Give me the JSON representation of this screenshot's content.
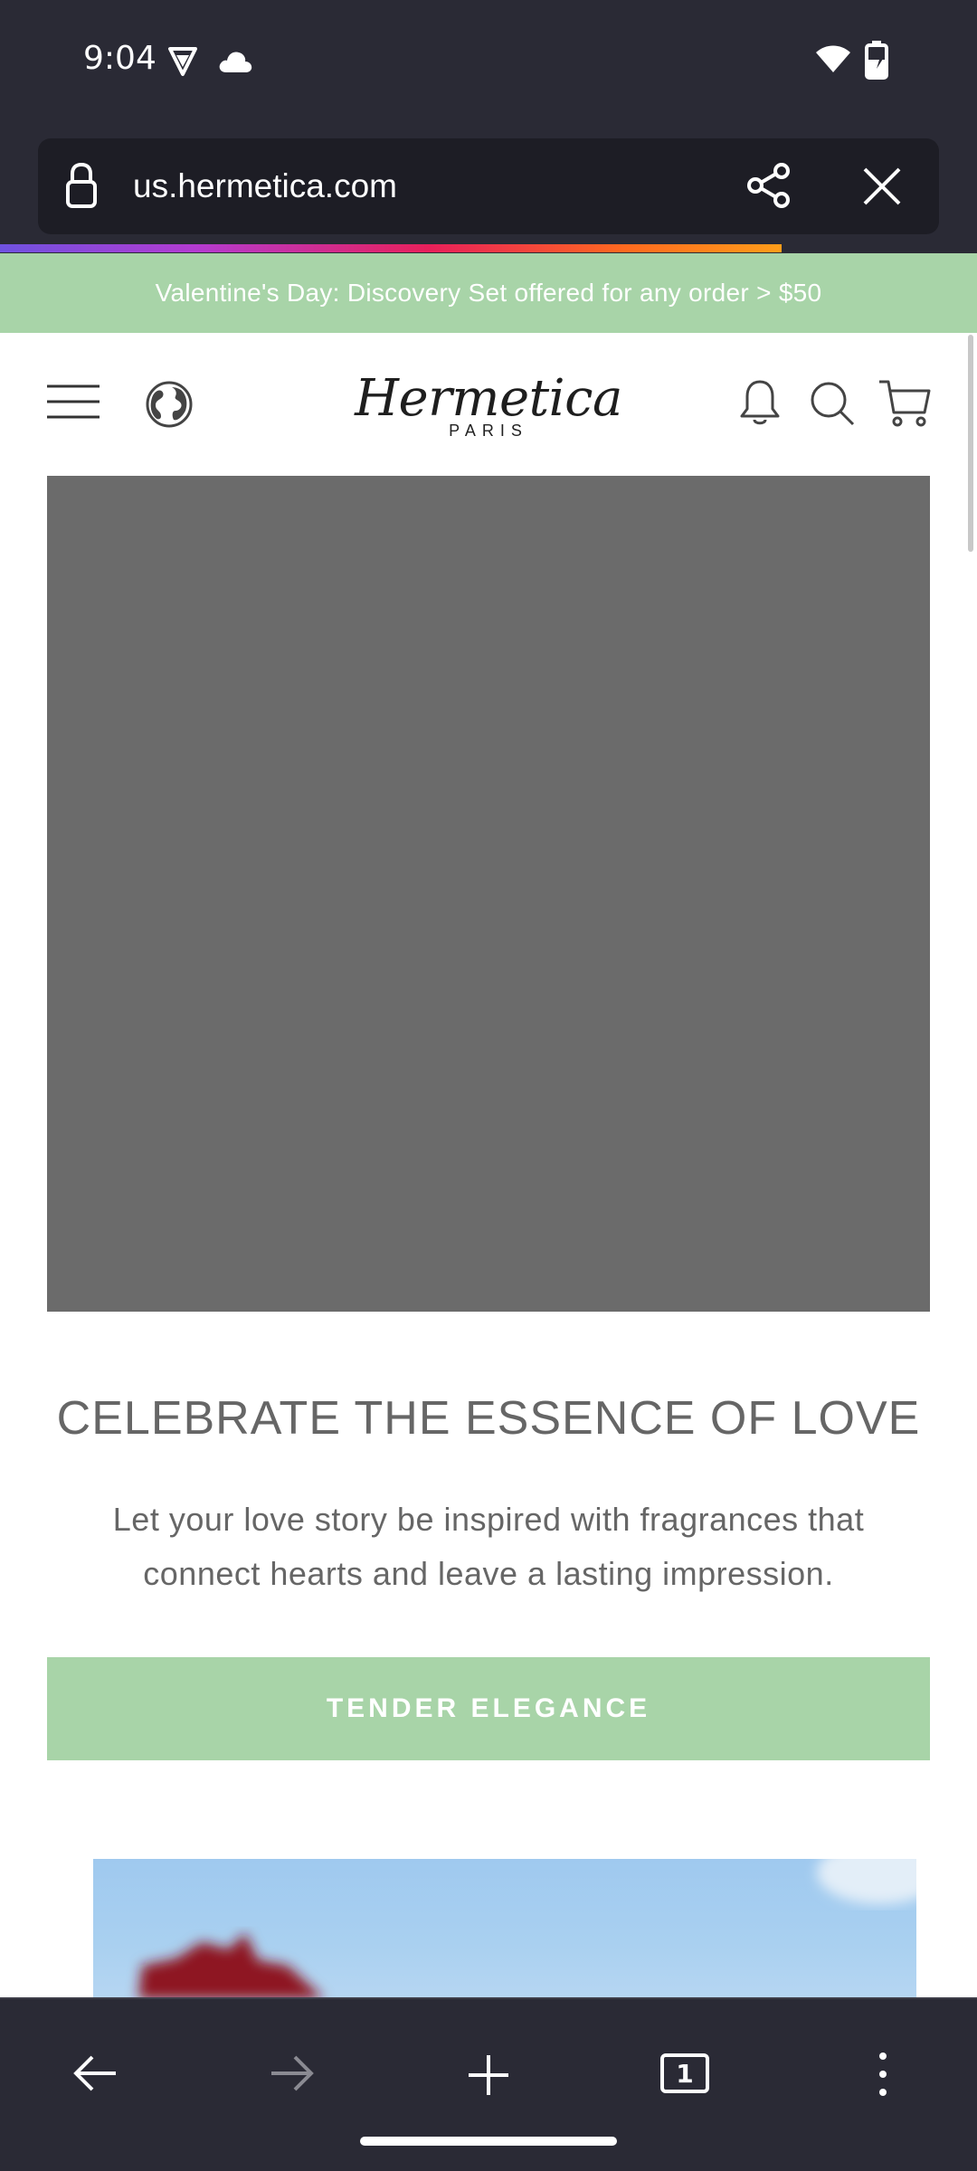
{
  "status_bar": {
    "time": "9:04",
    "icons": [
      "vpn-shield-icon",
      "cloud-icon",
      "wifi-icon",
      "battery-charging-icon"
    ]
  },
  "browser": {
    "url": "us.hermetica.com",
    "icons": [
      "lock-icon",
      "share-icon",
      "close-icon"
    ],
    "load_progress": 0.8
  },
  "promo_banner": {
    "text": "Valentine's Day: Discovery Set offered for any order > $50",
    "color": "#a8d4a8"
  },
  "header": {
    "logo": "Hermetica",
    "logo_sub": "PARIS",
    "icons": [
      "menu-icon",
      "globe-icon",
      "bell-icon",
      "search-icon",
      "cart-icon"
    ]
  },
  "hero": {
    "headline": "CELEBRATE THE ESSENCE OF LOVE",
    "subtext": "Let your love story be inspired with fragrances that connect hearts and leave a lasting impression.",
    "cta_label": "TENDER ELEGANCE",
    "cta_color": "#a8d4a8"
  },
  "toolbar": {
    "tab_count": "1",
    "icons": [
      "back-arrow-icon",
      "forward-arrow-icon",
      "new-tab-icon",
      "tab-switcher-icon",
      "more-options-icon"
    ]
  },
  "colors": {
    "chrome_bg": "#2a2a35",
    "accent_green": "#a8d4a8",
    "text_gray": "#666666"
  }
}
